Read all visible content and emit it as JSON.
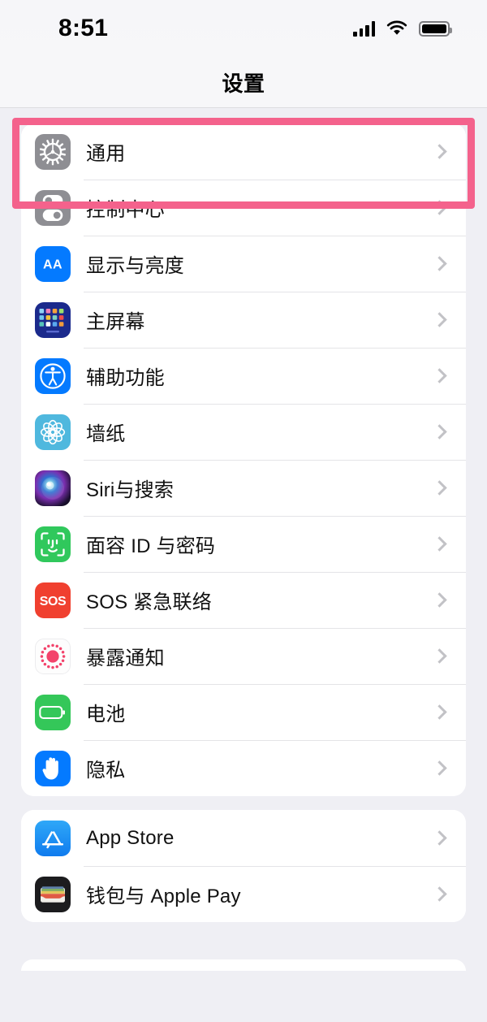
{
  "status_bar": {
    "time": "8:51",
    "icons": [
      "cellular-signal-icon",
      "wifi-icon",
      "battery-icon"
    ]
  },
  "navbar": {
    "title": "设置"
  },
  "highlight": {
    "color": "#F4628C",
    "target": "通用"
  },
  "colors": {
    "page_background": "#EFEFF4",
    "card_background": "#FFFFFF",
    "separator": "#E4E4E7",
    "chevron": "#C2C2C6",
    "highlight": "#F4628C"
  },
  "groups": [
    {
      "name": "system-group",
      "rows": [
        {
          "label": "通用",
          "icon": "gear-icon",
          "icon_class": "ic-gear",
          "chevron": true
        },
        {
          "label": "控制中心",
          "icon": "control-center-icon",
          "icon_class": "ic-control",
          "chevron": true
        },
        {
          "label": "显示与亮度",
          "icon": "display-brightness-icon",
          "icon_class": "ic-display",
          "chevron": true
        },
        {
          "label": "主屏幕",
          "icon": "home-screen-icon",
          "icon_class": "ic-home",
          "chevron": true
        },
        {
          "label": "辅助功能",
          "icon": "accessibility-icon",
          "icon_class": "ic-access",
          "chevron": true
        },
        {
          "label": "墙纸",
          "icon": "wallpaper-icon",
          "icon_class": "ic-wall",
          "chevron": true
        },
        {
          "label": "Siri与搜索",
          "icon": "siri-icon",
          "icon_class": "ic-siri",
          "chevron": true
        },
        {
          "label": "面容 ID 与密码",
          "icon": "face-id-icon",
          "icon_class": "ic-faceid",
          "chevron": true
        },
        {
          "label": "SOS 紧急联络",
          "icon": "emergency-sos-icon",
          "icon_class": "ic-sos",
          "chevron": true
        },
        {
          "label": "暴露通知",
          "icon": "exposure-notification-icon",
          "icon_class": "ic-expose",
          "chevron": true
        },
        {
          "label": "电池",
          "icon": "battery-settings-icon",
          "icon_class": "ic-battery",
          "chevron": true
        },
        {
          "label": "隐私",
          "icon": "privacy-hand-icon",
          "icon_class": "ic-privacy",
          "chevron": true
        }
      ]
    },
    {
      "name": "store-group",
      "rows": [
        {
          "label": "App Store",
          "icon": "app-store-icon",
          "icon_class": "ic-appstore",
          "chevron": true
        },
        {
          "label": "钱包与 Apple Pay",
          "icon": "wallet-icon",
          "icon_class": "ic-wallet",
          "chevron": true
        }
      ]
    }
  ]
}
